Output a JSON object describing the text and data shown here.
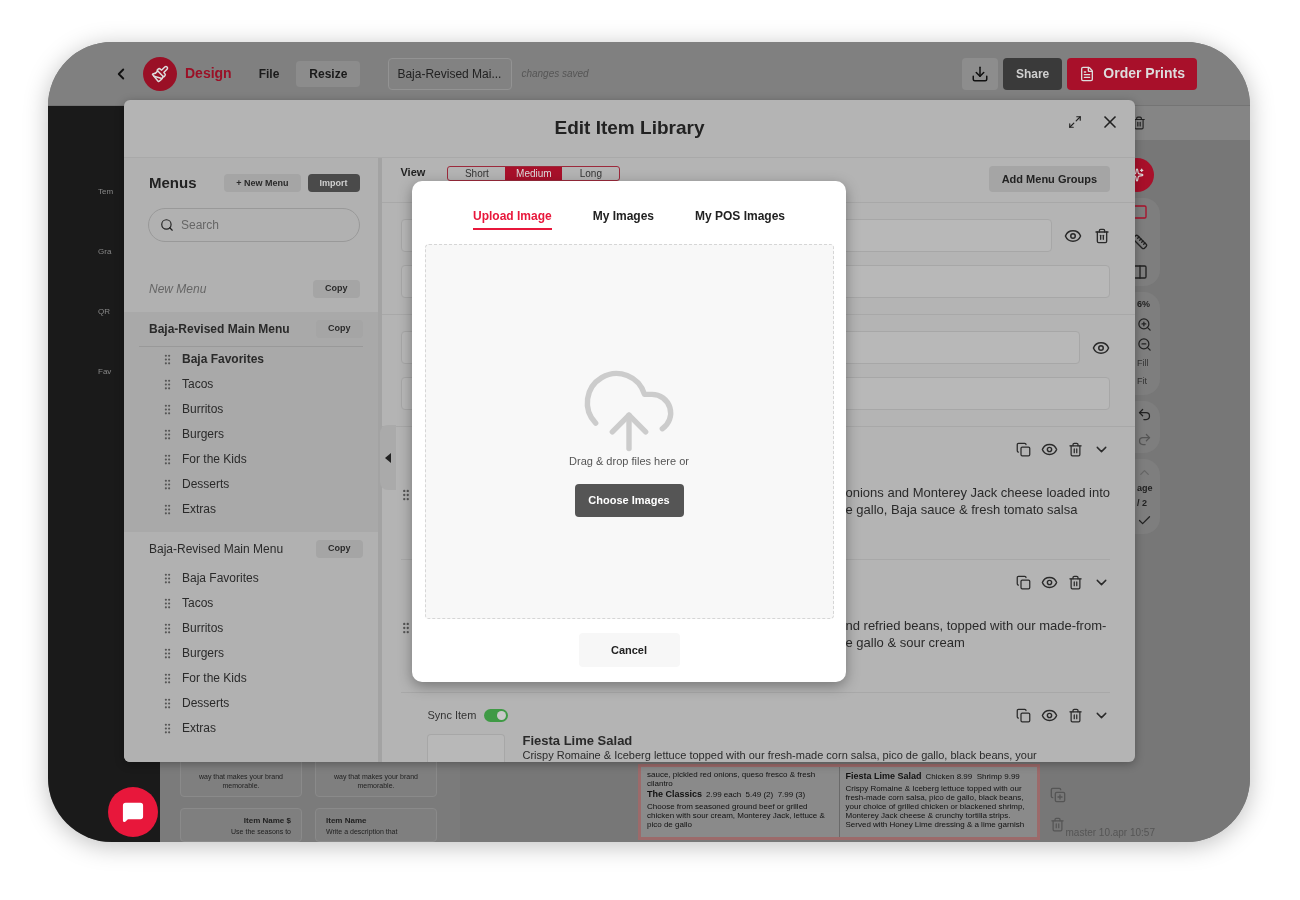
{
  "app_bar": {
    "brand": "Design",
    "menus": [
      {
        "label": "File",
        "selected": false
      },
      {
        "label": "Resize",
        "selected": true
      }
    ],
    "document_name": "Baja-Revised Mai...",
    "save_status": "changes saved",
    "share": "Share",
    "order": "Order Prints"
  },
  "left_rail": [
    "Tem",
    "Gra",
    "QR",
    "Fav"
  ],
  "templates": [
    {
      "text": "way that makes your brand memorable."
    },
    {
      "text": "way that makes your brand memorable."
    },
    {
      "title": "Item Name $",
      "text": "Use the seasons to"
    },
    {
      "title": "Item Name",
      "text": "Write a description that"
    }
  ],
  "menu_preview": {
    "columns": [
      {
        "lead": "sauce, pickled red onions, queso fresco & fresh cilantro",
        "name": "The Classics",
        "price": "2.99 each  5.49 (2)  7.99 (3)",
        "description": "Choose from seasoned ground beef or grilled chicken with sour cream, Monterey Jack, lettuce & pico de gallo"
      },
      {
        "name": "Fiesta Lime Salad",
        "price": "Chicken 8.99  Shrimp 9.99",
        "description": "Crispy Romaine & Iceberg lettuce topped with our fresh-made corn salsa, pico de gallo, black beans, your choice of grilled chicken or blackened shrimp, Monterey Jack cheese & crunchy tortilla strips. Served with Honey Lime dressing & a lime garnish"
      }
    ]
  },
  "right_tools": {
    "zoom": "6%",
    "fill": "Fill",
    "fit": "Fit",
    "page": "age",
    "page_count": "/ 2"
  },
  "status": "master 10.apr 10:57",
  "dialog": {
    "title": "Edit Item Library",
    "menus_panel": {
      "heading": "Menus",
      "new_button": "+ New Menu",
      "import_button": "Import",
      "search_placeholder": "Search",
      "draft": {
        "name": "New Menu",
        "copy": "Copy"
      },
      "menus": [
        {
          "name": "Baja-Revised Main Menu",
          "copy": "Copy",
          "selected": true,
          "groups": [
            {
              "label": "Baja Favorites",
              "selected": true
            },
            {
              "label": "Tacos",
              "selected": false
            },
            {
              "label": "Burritos",
              "selected": false
            },
            {
              "label": "Burgers",
              "selected": false
            },
            {
              "label": "For the Kids",
              "selected": false
            },
            {
              "label": "Desserts",
              "selected": false
            },
            {
              "label": "Extras",
              "selected": false
            }
          ]
        },
        {
          "name": "Baja-Revised Main Menu",
          "copy": "Copy",
          "selected": false,
          "groups": [
            {
              "label": "Baja Favorites",
              "selected": false
            },
            {
              "label": "Tacos",
              "selected": false
            },
            {
              "label": "Burritos",
              "selected": false
            },
            {
              "label": "Burgers",
              "selected": false
            },
            {
              "label": "For the Kids",
              "selected": false
            },
            {
              "label": "Desserts",
              "selected": false
            },
            {
              "label": "Extras",
              "selected": false
            }
          ]
        }
      ]
    },
    "items_panel": {
      "view_label": "View",
      "views": [
        {
          "label": "Short",
          "selected": false
        },
        {
          "label": "Medium",
          "selected": true
        },
        {
          "label": "Long",
          "selected": false
        }
      ],
      "add_groups": "Add Menu Groups",
      "rows": [
        {
          "kind": "group",
          "deletable": true
        },
        {
          "kind": "group",
          "deletable": false
        },
        {
          "kind": "item",
          "description": [
            "onions and Monterey Jack cheese loaded into",
            "e gallo, Baja sauce & fresh tomato salsa"
          ]
        },
        {
          "kind": "item",
          "description": [
            "nd refried beans, topped with our made-from-",
            "e gallo & sour cream"
          ]
        },
        {
          "kind": "synced",
          "sync": {
            "label": "Sync Item",
            "on": true
          },
          "name": "Fiesta Lime Salad",
          "description": [
            "Crispy Romaine & Iceberg lettuce topped with our fresh-made corn salsa, pico de gallo, black beans, your"
          ]
        }
      ]
    }
  },
  "upload_dialog": {
    "tabs": [
      {
        "label": "Upload Image",
        "selected": true
      },
      {
        "label": "My Images",
        "selected": false
      },
      {
        "label": "My POS Images",
        "selected": false
      }
    ],
    "drop_hint": "Drag & drop files here or",
    "choose_button": "Choose Images",
    "cancel_button": "Cancel"
  }
}
